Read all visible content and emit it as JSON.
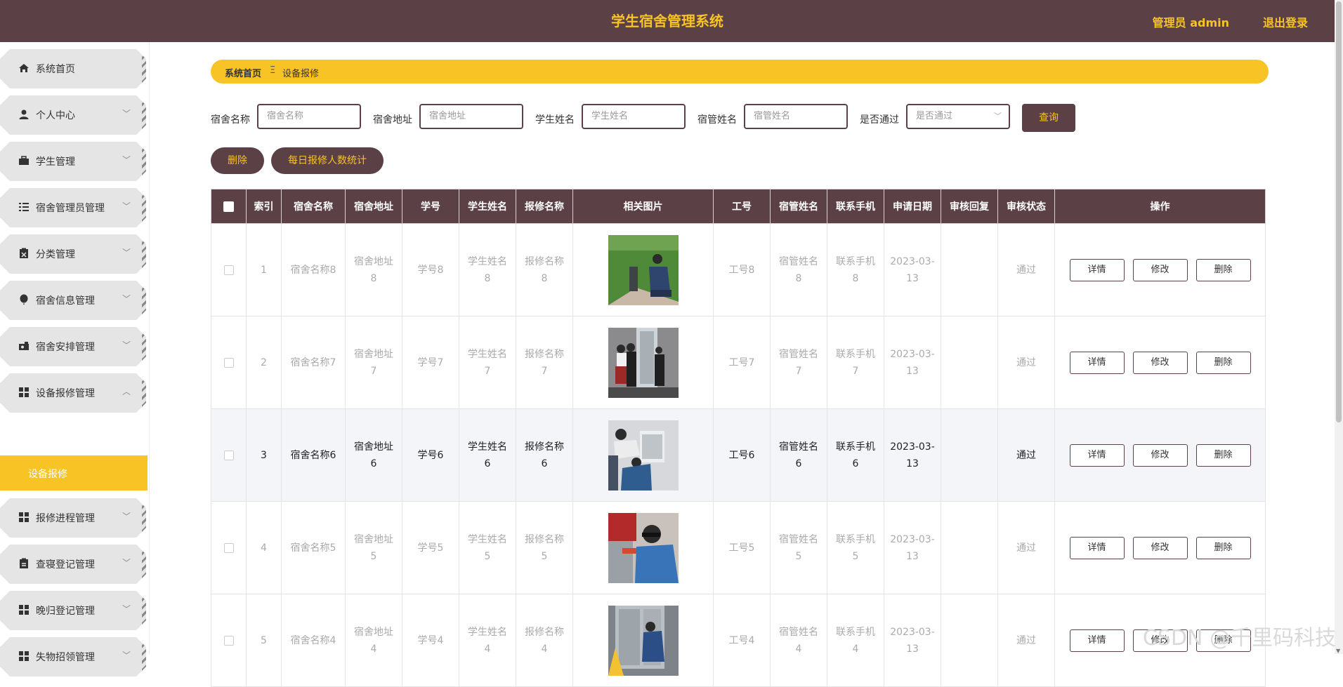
{
  "header": {
    "title": "学生宿舍管理系统",
    "user": "管理员 admin",
    "logout": "退出登录"
  },
  "sidebar": {
    "items": [
      {
        "label": "系统首页",
        "icon": "home-icon"
      },
      {
        "label": "个人中心",
        "icon": "user-icon"
      },
      {
        "label": "学生管理",
        "icon": "briefcase-icon"
      },
      {
        "label": "宿舍管理员管理",
        "icon": "list-icon"
      },
      {
        "label": "分类管理",
        "icon": "clipboard-icon"
      },
      {
        "label": "宿舍信息管理",
        "icon": "balloon-icon"
      },
      {
        "label": "宿舍安排管理",
        "icon": "camera-icon"
      },
      {
        "label": "设备报修管理",
        "icon": "grid-icon"
      },
      {
        "label": "报修进程管理",
        "icon": "grid-icon"
      },
      {
        "label": "查寝登记管理",
        "icon": "clipboard-icon"
      },
      {
        "label": "晚归登记管理",
        "icon": "grid-icon"
      },
      {
        "label": "失物招领管理",
        "icon": "grid-icon"
      }
    ],
    "active_sub": "设备报修"
  },
  "breadcrumb": {
    "home": "系统首页",
    "separator": "Ξ",
    "current": "设备报修"
  },
  "search": {
    "fields": [
      {
        "label": "宿舍名称",
        "placeholder": "宿舍名称"
      },
      {
        "label": "宿舍地址",
        "placeholder": "宿舍地址"
      },
      {
        "label": "学生姓名",
        "placeholder": "学生姓名"
      },
      {
        "label": "宿管姓名",
        "placeholder": "宿管姓名"
      },
      {
        "label": "是否通过",
        "placeholder": "是否通过"
      }
    ],
    "query_button": "查询"
  },
  "actions": {
    "delete": "删除",
    "stats": "每日报修人数统计"
  },
  "table": {
    "headers": [
      "索引",
      "宿舍名称",
      "宿舍地址",
      "学号",
      "学生姓名",
      "报修名称",
      "相关图片",
      "工号",
      "宿管姓名",
      "联系手机",
      "申请日期",
      "审核回复",
      "审核状态",
      "操作"
    ],
    "rows": [
      {
        "index": "1",
        "dorm_name": "宿舍名称8",
        "dorm_addr": "宿舍地址8",
        "student_no": "学号8",
        "student_name": "学生姓名8",
        "repair_name": "报修名称8",
        "image": "grass-repair-photo",
        "job_no": "工号8",
        "manager_name": "宿管姓名8",
        "phone": "联系手机8",
        "date": "2023-03-13",
        "reply": "",
        "status": "通过"
      },
      {
        "index": "2",
        "dorm_name": "宿舍名称7",
        "dorm_addr": "宿舍地址7",
        "student_no": "学号7",
        "student_name": "学生姓名7",
        "repair_name": "报修名称7",
        "image": "elevator-repair-photo",
        "job_no": "工号7",
        "manager_name": "宿管姓名7",
        "phone": "联系手机7",
        "date": "2023-03-13",
        "reply": "",
        "status": "通过"
      },
      {
        "index": "3",
        "dorm_name": "宿舍名称6",
        "dorm_addr": "宿舍地址6",
        "student_no": "学号6",
        "student_name": "学生姓名6",
        "repair_name": "报修名称6",
        "image": "panel-repair-photo",
        "job_no": "工号6",
        "manager_name": "宿管姓名6",
        "phone": "联系手机6",
        "date": "2023-03-13",
        "reply": "",
        "status": "通过"
      },
      {
        "index": "4",
        "dorm_name": "宿舍名称5",
        "dorm_addr": "宿舍地址5",
        "student_no": "学号5",
        "student_name": "学生姓名5",
        "repair_name": "报修名称5",
        "image": "welding-repair-photo",
        "job_no": "工号5",
        "manager_name": "宿管姓名5",
        "phone": "联系手机5",
        "date": "2023-03-13",
        "reply": "",
        "status": "通过"
      },
      {
        "index": "5",
        "dorm_name": "宿舍名称4",
        "dorm_addr": "宿舍地址4",
        "student_no": "学号4",
        "student_name": "学生姓名4",
        "repair_name": "报修名称4",
        "image": "door-repair-photo",
        "job_no": "工号4",
        "manager_name": "宿管姓名4",
        "phone": "联系手机4",
        "date": "2023-03-13",
        "reply": "",
        "status": "通过"
      }
    ],
    "row_actions": {
      "detail": "详情",
      "edit": "修改",
      "delete": "删除"
    }
  },
  "watermark": "CSDN @千里码科技",
  "colors": {
    "primary": "#5b4046",
    "accent": "#f7c325"
  }
}
